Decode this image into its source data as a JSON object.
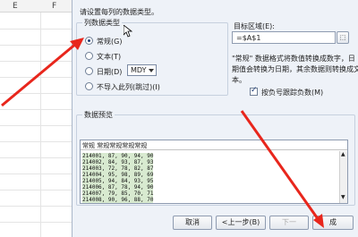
{
  "spreadsheet": {
    "columns": [
      "E",
      "F"
    ]
  },
  "dialog": {
    "instruction": "请设置每列的数据类型。",
    "column_type": {
      "group_title": "列数据类型",
      "options": [
        "常规(G)",
        "文本(T)",
        "日期(D)",
        "不导入此列(跳过)(I)"
      ],
      "selected_index": 0,
      "date_format": "MDY"
    },
    "target": {
      "label": "目标区域(E):",
      "value": "=$A$1"
    },
    "note": {
      "line1": "\"常规\" 数据格式将数值转换成数字，日",
      "line2": "期值会转换为日期，其余数据则转换成文",
      "line3": "本。"
    },
    "negative_checkbox": {
      "label": "按负号跟踪负数(M)",
      "checked": true
    },
    "preview": {
      "title": "数据预览",
      "header": "常规  常规常规常规常规",
      "rows": [
        "214001, 87, 90, 94, 90",
        "214002, 84, 93, 87, 93",
        "214003, 72, 78, 82, 87",
        "214004, 95, 98, 89, 69",
        "214005, 94, 84, 93, 95",
        "214006, 87, 78, 94, 90",
        "214007, 79, 85, 70, 71",
        "214008, 90, 96, 88, 70"
      ]
    },
    "buttons": {
      "cancel": "取消",
      "back": "<上一步(B)",
      "next": "下一",
      "finish": "成"
    }
  },
  "colors": {
    "arrow": "#e8261c",
    "dialog_bg": "#eef2f8"
  }
}
